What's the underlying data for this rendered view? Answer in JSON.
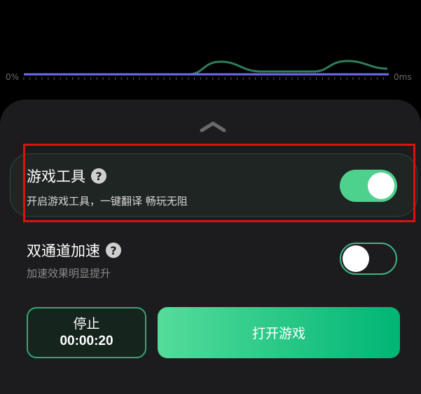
{
  "graph": {
    "left_label": "0%",
    "right_label": "0ms",
    "line_colors": {
      "baseline": "#6f6cf0",
      "latency": "#2e7d5c"
    }
  },
  "tool_row": {
    "title": "游戏工具",
    "subtitle": "开启游戏工具，一键翻译 畅玩无阻",
    "help_icon": "question-circle-icon",
    "toggle_on": true
  },
  "dual_row": {
    "title": "双通道加速",
    "subtitle": "加速效果明显提升",
    "help_icon": "question-circle-icon",
    "toggle_on": false
  },
  "actions": {
    "stop_label": "停止",
    "elapsed": "00:00:20",
    "open_label": "打开游戏"
  },
  "colors": {
    "accent": "#4fd18e",
    "highlight": "#e01010",
    "panel": "#1c1c1e"
  }
}
